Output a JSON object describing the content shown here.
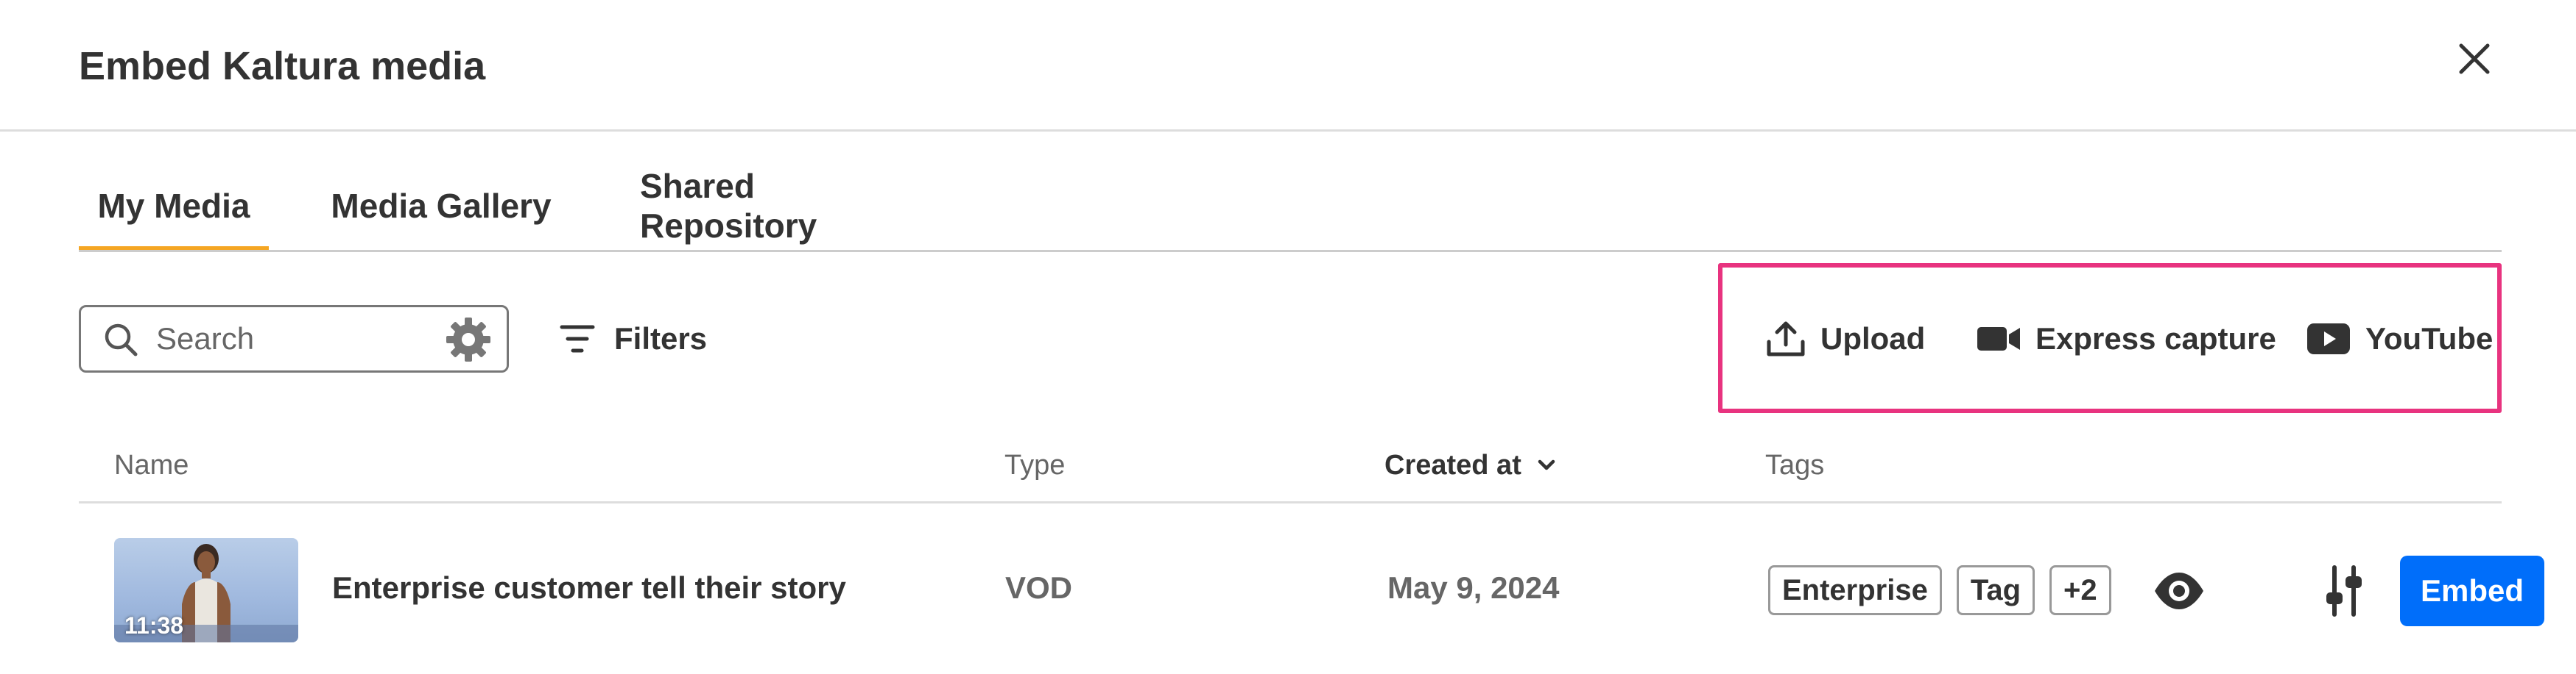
{
  "dialog": {
    "title": "Embed Kaltura media",
    "close_icon": "close-icon"
  },
  "tabs": [
    {
      "label": "My Media",
      "active": true
    },
    {
      "label": "Media Gallery",
      "active": false
    },
    {
      "label": "Shared Repository",
      "active": false
    }
  ],
  "toolbar": {
    "search": {
      "placeholder": "Search",
      "value": "",
      "icon": "search-icon",
      "settings_icon": "gear-icon"
    },
    "filters_label": "Filters",
    "filters_icon": "filter-lines-icon",
    "actions": [
      {
        "label": "Upload",
        "icon": "upload-icon"
      },
      {
        "label": "Express capture",
        "icon": "video-camera-icon"
      },
      {
        "label": "YouTube",
        "icon": "youtube-icon"
      }
    ],
    "highlight_color": "#e8337f"
  },
  "table": {
    "columns": [
      {
        "label": "Name",
        "sorted": false
      },
      {
        "label": "Type",
        "sorted": false
      },
      {
        "label": "Created at",
        "sorted": true,
        "sort_direction": "descending"
      },
      {
        "label": "Tags",
        "sorted": false
      }
    ],
    "rows": [
      {
        "name": "Enterprise customer tell their story",
        "type": "VOD",
        "created_at": "May 9, 2024",
        "duration": "11:38",
        "tags": [
          "Enterprise",
          "Tag",
          "+2"
        ],
        "actions": {
          "preview_icon": "eye-icon",
          "settings_icon": "sliders-icon",
          "embed_label": "Embed"
        }
      }
    ]
  },
  "colors": {
    "active_tab_underline": "#f5a623",
    "primary_button": "#006efa",
    "text_primary": "#333333",
    "text_secondary": "#666666"
  }
}
